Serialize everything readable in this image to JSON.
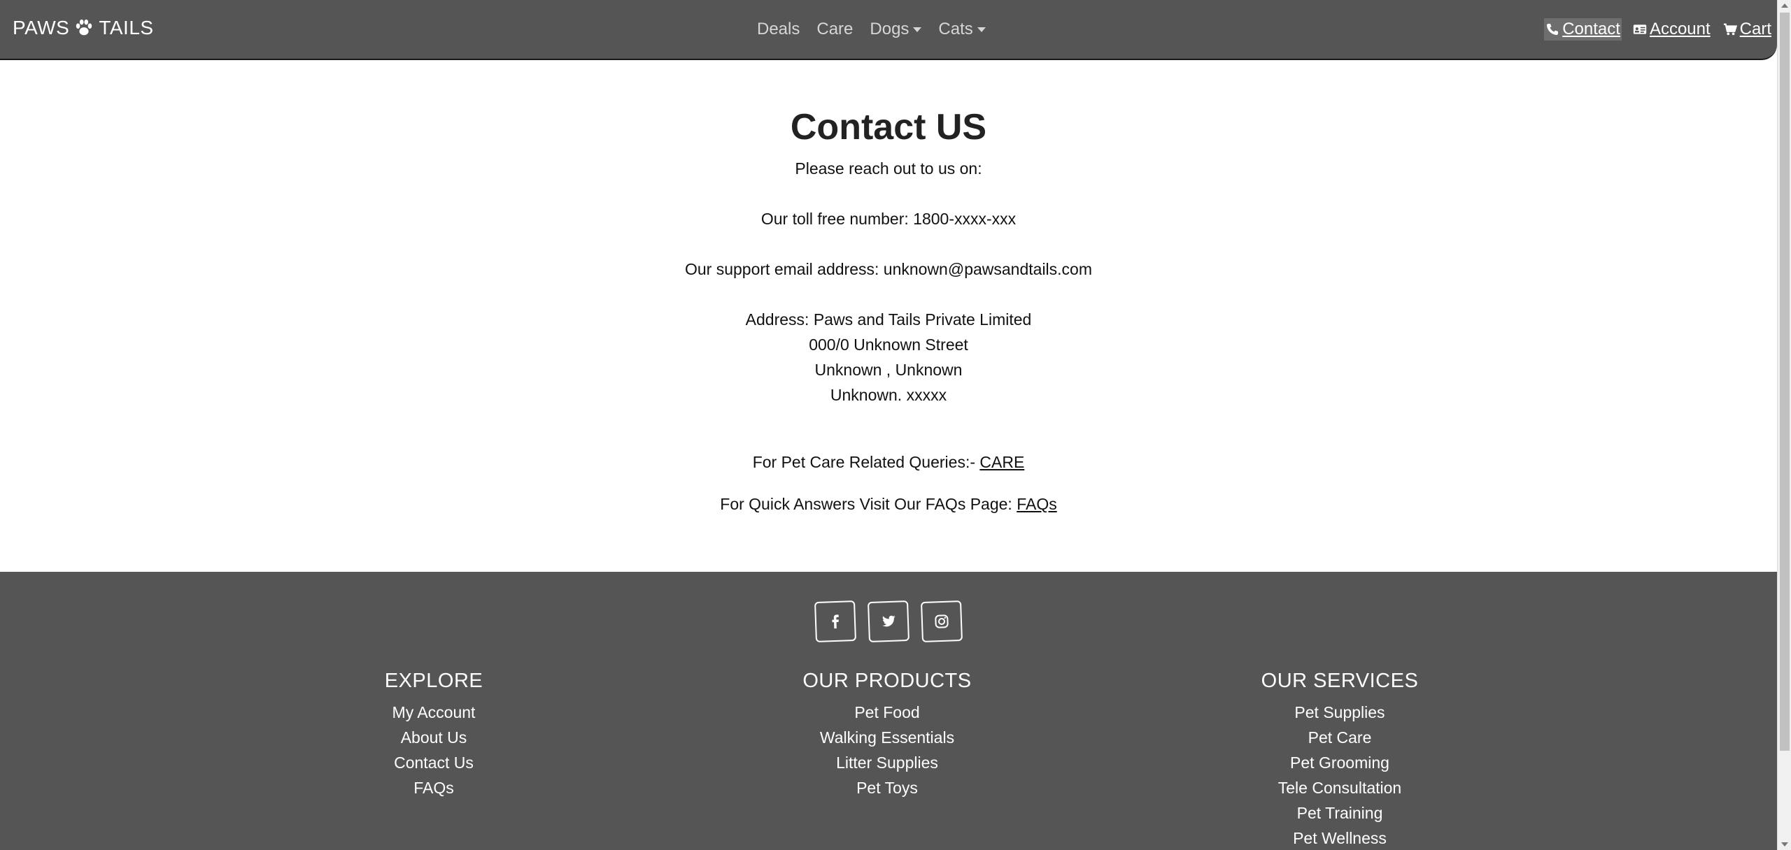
{
  "navbar": {
    "brand_left": "PAWS",
    "brand_icon": "paw-icon",
    "brand_right": "TAILS",
    "links": [
      {
        "label": "Deals",
        "dropdown": false
      },
      {
        "label": "Care",
        "dropdown": false
      },
      {
        "label": "Dogs",
        "dropdown": true
      },
      {
        "label": "Cats",
        "dropdown": true
      }
    ],
    "right_links": [
      {
        "label": "Contact",
        "icon": "phone-icon",
        "active": true
      },
      {
        "label": "Account",
        "icon": "id-card-icon",
        "active": false
      },
      {
        "label": "Cart",
        "icon": "cart-icon",
        "active": false
      }
    ]
  },
  "contact": {
    "title": "Contact US",
    "intro": "Please reach out to us on:",
    "phone": "Our toll free number: 1800-xxxx-xxx",
    "email": "Our support email address: unknown@pawsandtails.com",
    "address_lines": [
      "Address: Paws and Tails Private Limited",
      "000/0 Unknown Street",
      "Unknown , Unknown",
      "Unknown. xxxxx"
    ],
    "care_prefix": "For Pet Care Related Queries:- ",
    "care_link": "CARE",
    "faq_prefix": "For Quick Answers Visit Our FAQs Page: ",
    "faq_link": "FAQs"
  },
  "footer": {
    "social": [
      {
        "icon": "facebook-icon"
      },
      {
        "icon": "twitter-icon"
      },
      {
        "icon": "instagram-icon"
      }
    ],
    "explore": {
      "heading": "EXPLORE",
      "items": [
        "My Account",
        "About Us",
        "Contact Us",
        "FAQs"
      ]
    },
    "products": {
      "heading": "OUR PRODUCTS",
      "items": [
        "Pet Food",
        "Walking Essentials",
        "Litter Supplies",
        "Pet Toys"
      ]
    },
    "services": {
      "heading": "OUR SERVICES",
      "items": [
        "Pet Supplies",
        "Pet Care",
        "Pet Grooming",
        "Tele Consultation",
        "Pet Training",
        "Pet Wellness"
      ]
    }
  },
  "colors": {
    "navbar_bg": "#555555",
    "footer_bg": "#555555",
    "nav_link": "#d6d6d6",
    "text": "#111111"
  }
}
